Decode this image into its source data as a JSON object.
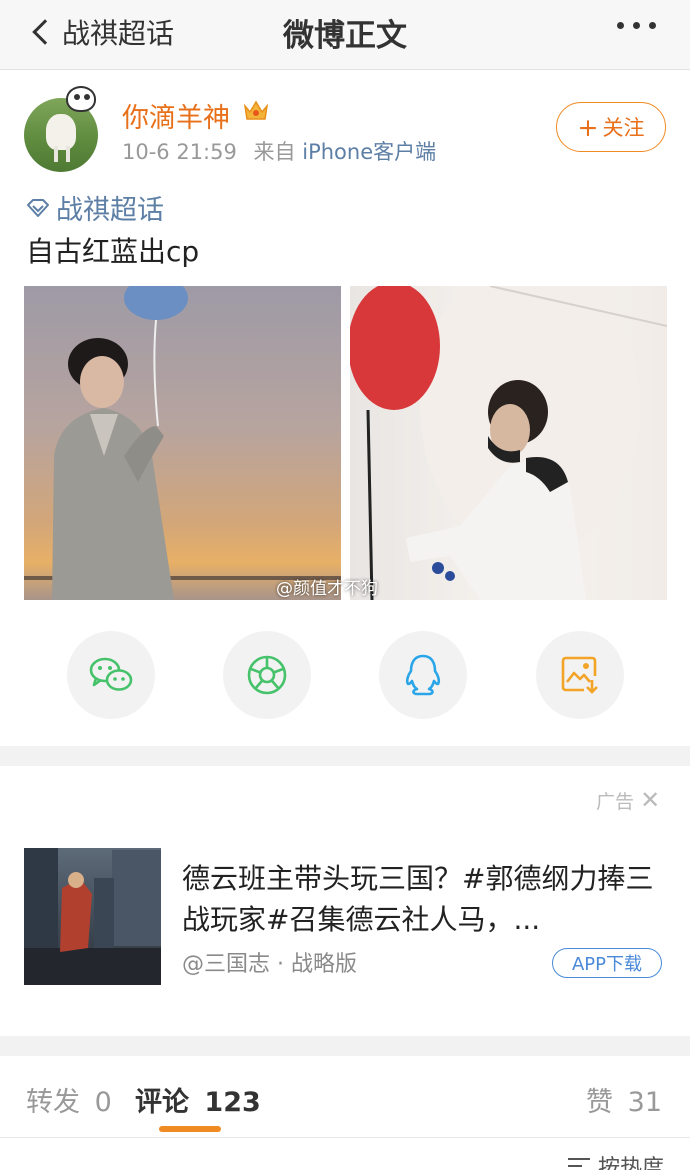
{
  "nav": {
    "back_label": "战祺超话",
    "title": "微博正文"
  },
  "post": {
    "username": "你滴羊神",
    "timestamp": "10-6 21:59",
    "source_prefix": "来自",
    "source": "iPhone客户端",
    "follow_label": "关注",
    "follow_plus": "+",
    "topic": "战祺超话",
    "text": "自古红蓝出cp",
    "watermark": "@颜值才不狗"
  },
  "share": [
    {
      "name": "wechat-icon",
      "color": "#45c26a"
    },
    {
      "name": "moments-icon",
      "color": "#45c26a"
    },
    {
      "name": "qq-icon",
      "color": "#2aa6e8"
    },
    {
      "name": "save-image-icon",
      "color": "#f3a326"
    }
  ],
  "ad": {
    "label": "广告",
    "title": "德云班主带头玩三国？#郭德纲力捧三战玩家#召集德云社人马，...",
    "source": "@三国志 · 战略版",
    "download_label": "APP下载"
  },
  "tabs": {
    "repost_label": "转发",
    "repost_count": "0",
    "comment_label": "评论",
    "comment_count": "123",
    "like_label": "赞",
    "like_count": "31"
  },
  "sort": {
    "label": "按热度"
  },
  "colors": {
    "accent": "#f08b24",
    "username": "#e8701a",
    "link": "#5d7fa6",
    "ad_button": "#4a8ad8"
  }
}
